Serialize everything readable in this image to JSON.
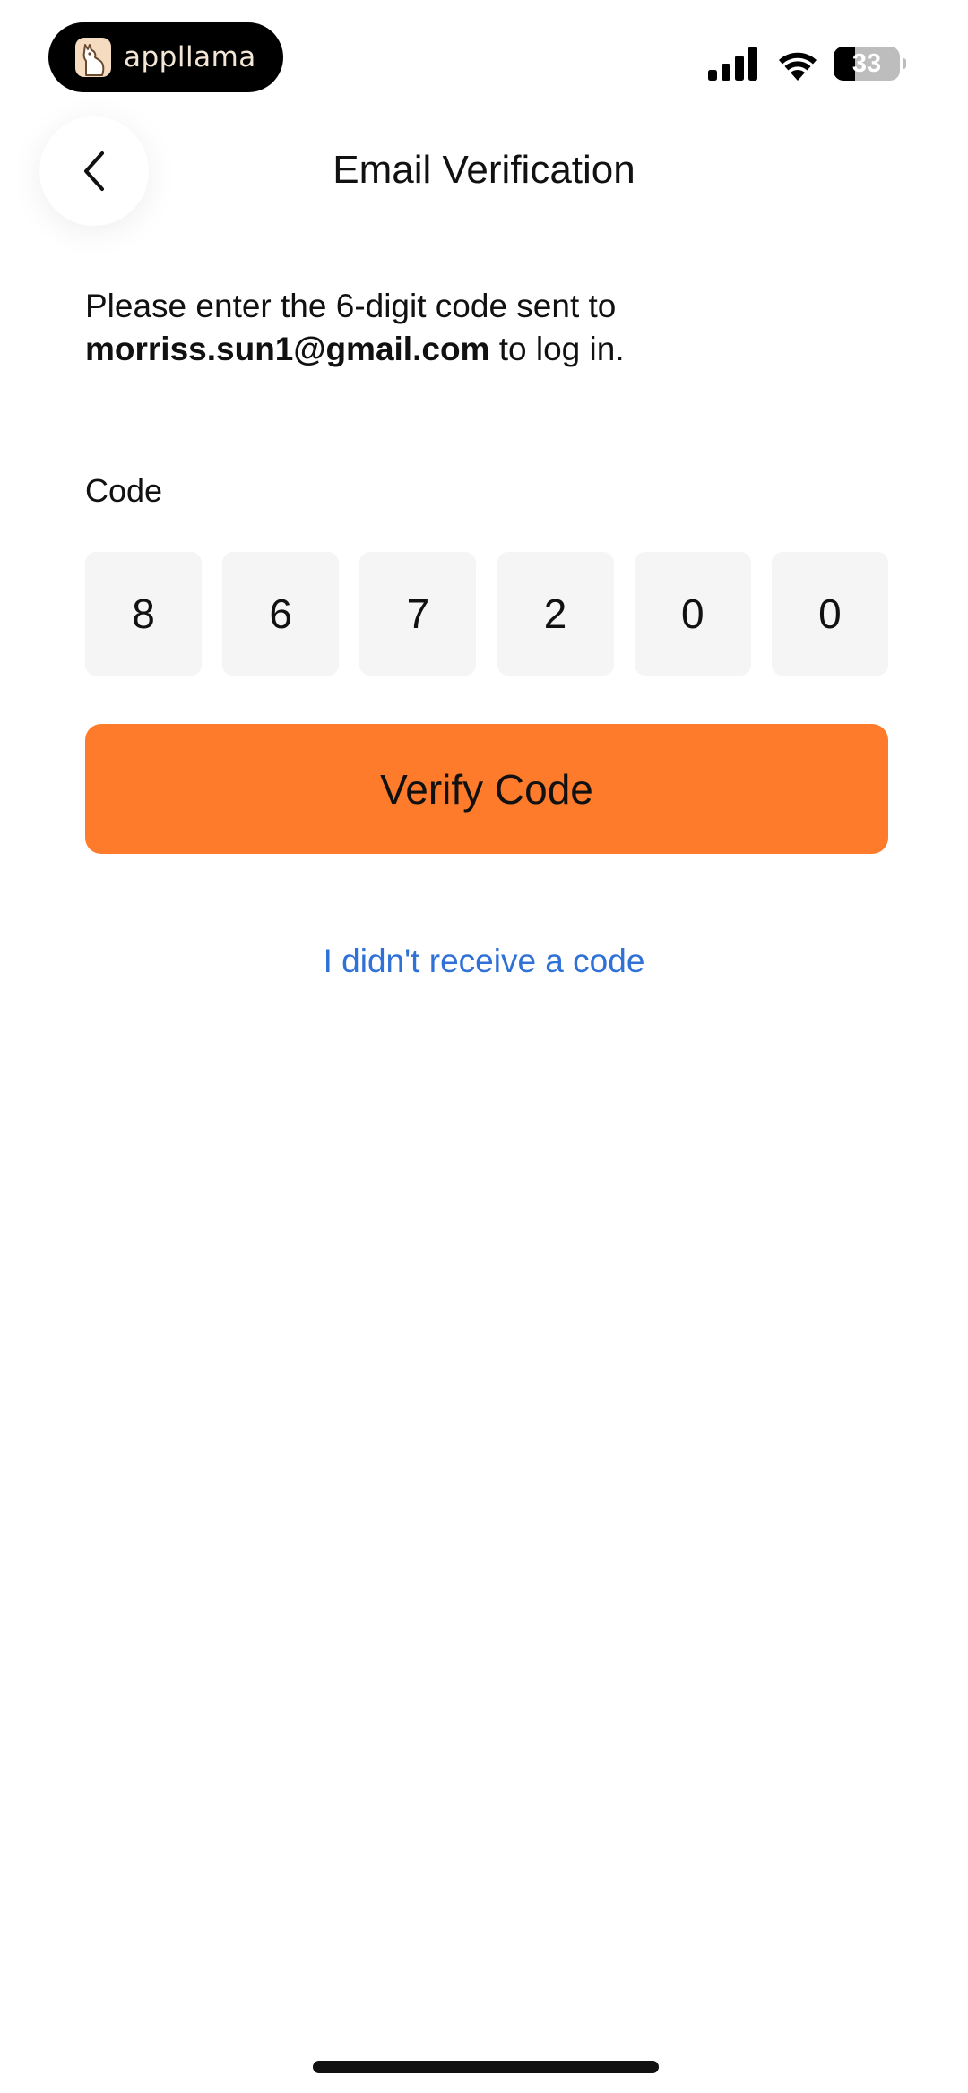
{
  "status_bar": {
    "app_name": "appllama",
    "battery_level": "33",
    "battery_percent": 33
  },
  "header": {
    "title": "Email Verification",
    "back_icon": "chevron-left-icon"
  },
  "description": {
    "line1": "Please enter the 6-digit code sent to",
    "email": "morriss.sun1@gmail.com",
    "suffix": " to log in."
  },
  "code": {
    "label": "Code",
    "digits": [
      "8",
      "6",
      "7",
      "2",
      "0",
      "0"
    ]
  },
  "actions": {
    "verify_label": "Verify Code",
    "resend_label": "I didn't receive a code"
  },
  "colors": {
    "accent": "#fd7b2a",
    "link": "#2f71d6",
    "input_bg": "#f5f5f5"
  }
}
